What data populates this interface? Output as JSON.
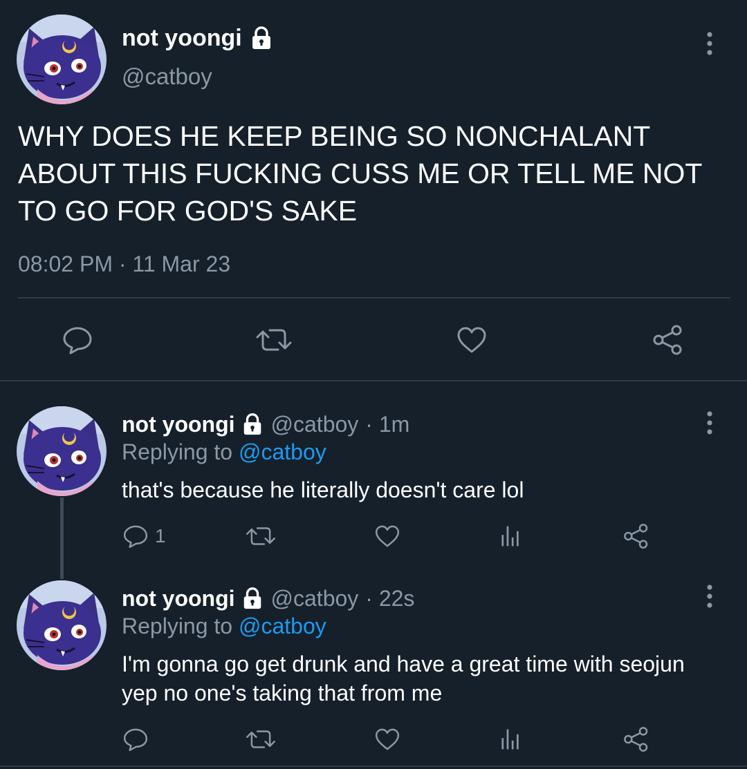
{
  "colors": {
    "background": "#15202b",
    "text_primary": "#ffffff",
    "text_secondary": "#8b98a5",
    "link": "#1d9bf0",
    "divider": "#2f3b47"
  },
  "main_tweet": {
    "avatar_icon": "avatar-cat-icon",
    "display_name": "not yoongi",
    "protected_icon": "lock-icon",
    "handle": "@catboy",
    "text": "WHY DOES HE KEEP BEING SO NONCHALANT ABOUT THIS FUCKING CUSS ME OR TELL ME NOT TO GO FOR GOD'S SAKE",
    "timestamp": "08:02 PM · 11 Mar 23",
    "actions": [
      "reply-icon",
      "retweet-icon",
      "like-icon",
      "share-icon"
    ]
  },
  "replies": [
    {
      "display_name": "not yoongi",
      "handle": "@catboy",
      "age": "· 1m",
      "replying_label": "Replying to",
      "replying_to": "@catboy",
      "text": "that's because he literally doesn't care lol",
      "reply_count": "1",
      "actions": [
        "reply-icon",
        "retweet-icon",
        "like-icon",
        "analytics-icon",
        "share-icon"
      ]
    },
    {
      "display_name": "not yoongi",
      "handle": "@catboy",
      "age": "· 22s",
      "replying_label": "Replying to",
      "replying_to": "@catboy",
      "text": "I'm gonna go get drunk and have a great time with seojun yep no one's taking that from me",
      "reply_count": "",
      "actions": [
        "reply-icon",
        "retweet-icon",
        "like-icon",
        "analytics-icon",
        "share-icon"
      ]
    }
  ]
}
